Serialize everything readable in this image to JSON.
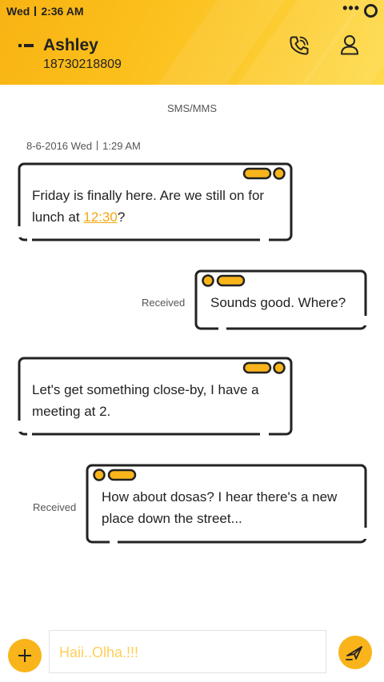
{
  "status_bar": {
    "day": "Wed",
    "time": "2:36 AM",
    "overflow": "•••"
  },
  "header": {
    "contact_name": "Ashley",
    "contact_number": "18730218809",
    "icons": {
      "back": "back-icon",
      "call": "phone-icon",
      "profile": "person-icon"
    }
  },
  "conversation": {
    "channel_label": "SMS/MMS",
    "date": "8-6-2016 Wed",
    "time": "1:29 AM",
    "messages": [
      {
        "direction": "incoming",
        "text_before": "Friday is finally here. Are we still on for lunch at ",
        "link": "12:30",
        "text_after": "?"
      },
      {
        "direction": "outgoing",
        "status": "Received",
        "text": "Sounds good. Where?"
      },
      {
        "direction": "incoming",
        "text": "Let's get something close-by, I have a meeting at 2."
      },
      {
        "direction": "outgoing",
        "status": "Received",
        "text": "How about dosas? I hear there's a new place down the street..."
      }
    ]
  },
  "composer": {
    "placeholder": "Haii..Olha.!!!",
    "add_icon": "plus-icon",
    "send_icon": "send-icon"
  },
  "colors": {
    "accent": "#f8b41a",
    "link": "#f4a712",
    "text": "#222222",
    "placeholder": "#fcd05a"
  }
}
